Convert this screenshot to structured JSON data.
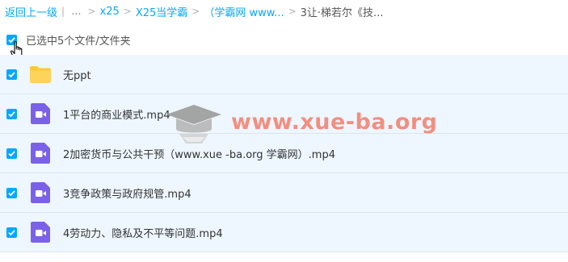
{
  "breadcrumb": {
    "back": "返回上一级",
    "sep_bar": "|",
    "ellipsis": "...",
    "items": [
      "x25",
      "X25当学霸",
      "（学霸网 www...",
      "3让·梯若尔《技..."
    ]
  },
  "selection": {
    "label": "已选中5个文件/文件夹"
  },
  "files": [
    {
      "name": "无ppt",
      "type": "folder",
      "selected": true
    },
    {
      "name": "1平台的商业模式.mp4",
      "type": "video",
      "selected": true
    },
    {
      "name": "2加密货币与公共干预（www.xue -ba.org 学霸网）.mp4",
      "type": "video",
      "selected": true
    },
    {
      "name": "3竞争政策与政府规管.mp4",
      "type": "video",
      "selected": true
    },
    {
      "name": "4劳动力、隐私及不平等问题.mp4",
      "type": "video",
      "selected": true
    }
  ],
  "watermark": {
    "text": "www.xue-ba.org"
  },
  "colors": {
    "accent": "#06a7ff",
    "row_bg": "#eef7ff",
    "video_icon": "#7b61e8",
    "folder": "#fcc93d",
    "watermark": "#f47e6a"
  }
}
